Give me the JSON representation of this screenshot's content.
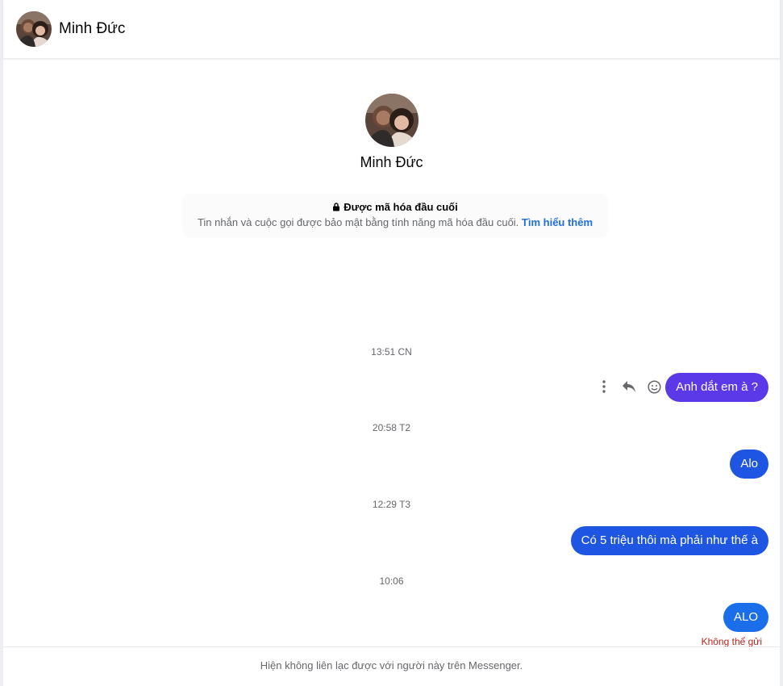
{
  "header": {
    "contact_name": "Minh Đức"
  },
  "profile": {
    "name": "Minh Đức"
  },
  "encryption": {
    "title": "Được mã hóa đầu cuối",
    "description": "Tin nhắn và cuộc gọi được bảo mật bằng tính năng mã hóa đầu cuối.",
    "link": "Tìm hiểu thêm"
  },
  "messages": [
    {
      "timestamp": "13:51 CN",
      "text": "Anh dắt em à ?"
    },
    {
      "timestamp": "20:58 T2",
      "text": "Alo"
    },
    {
      "timestamp": "12:29 T3",
      "text": "Có 5 triệu thôi mà phải như thế à"
    },
    {
      "timestamp": "10:06",
      "text": "ALO",
      "status": "Không thể gửi"
    }
  ],
  "message_actions": [
    "more-vertical-icon",
    "reply-icon",
    "emoji-icon"
  ],
  "footer": {
    "notice": "Hiện không liên lạc được với người này trên Messenger."
  },
  "colors": {
    "bubble_purple": "#5b39e8",
    "bubble_blue": "#1f55e3",
    "bubble_blue_light": "#1b6ee9",
    "link": "#216fdb",
    "error": "#b3261e"
  }
}
